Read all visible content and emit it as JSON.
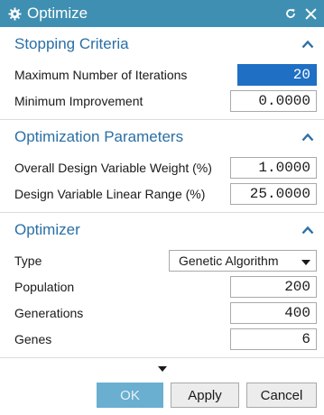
{
  "title_bar": {
    "title": "Optimize",
    "app_icon": "gear-icon",
    "reset_icon": "reset-icon",
    "close_icon": "close-icon"
  },
  "groups": {
    "stopping": {
      "title": "Stopping Criteria",
      "max_iterations_label": "Maximum Number of Iterations",
      "max_iterations_value": "20",
      "min_improvement_label": "Minimum Improvement",
      "min_improvement_value": "0.0000"
    },
    "parameters": {
      "title": "Optimization Parameters",
      "weight_label": "Overall Design Variable Weight (%)",
      "weight_value": "1.0000",
      "range_label": "Design Variable Linear Range (%)",
      "range_value": "25.0000"
    },
    "optimizer": {
      "title": "Optimizer",
      "type_label": "Type",
      "type_value": "Genetic Algorithm",
      "population_label": "Population",
      "population_value": "200",
      "generations_label": "Generations",
      "generations_value": "400",
      "genes_label": "Genes",
      "genes_value": "6"
    }
  },
  "footer": {
    "ok_label": "OK",
    "apply_label": "Apply",
    "cancel_label": "Cancel"
  },
  "colors": {
    "title_bar": "#3f8fb2",
    "group_title": "#2a6fa6",
    "selected_field": "#1f6fc4",
    "ok_button": "#6aaed0"
  }
}
